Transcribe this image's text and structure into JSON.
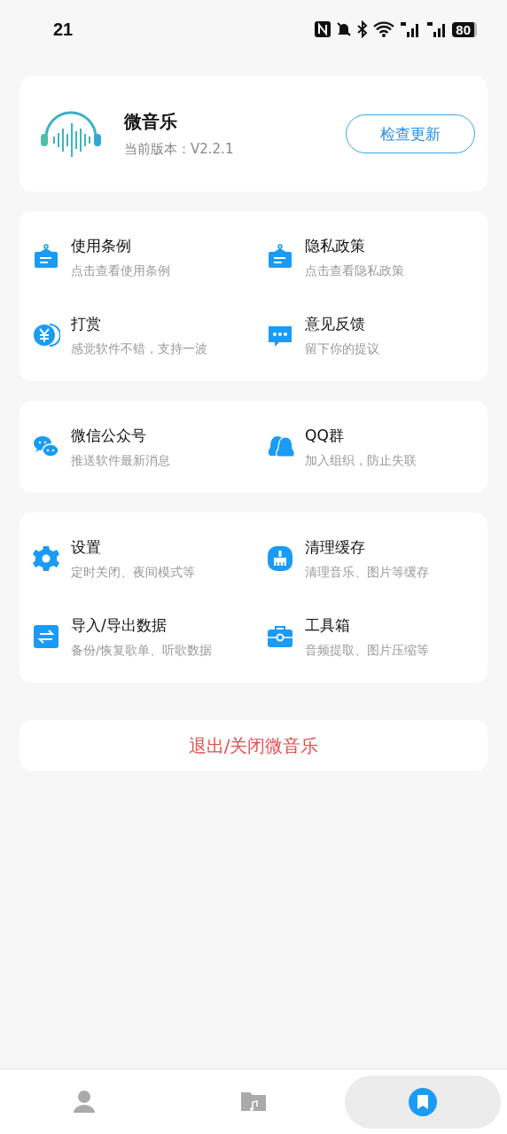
{
  "status_bar": {
    "time": "21",
    "battery": "80"
  },
  "app_card": {
    "name": "微音乐",
    "version": "当前版本：V2.2.1",
    "update_button": "检查更新"
  },
  "groups": [
    {
      "items": [
        {
          "kind": "notice",
          "title": "使用条例",
          "subtitle": "点击查看使用条例"
        },
        {
          "kind": "notice",
          "title": "隐私政策",
          "subtitle": "点击查看隐私政策"
        },
        {
          "kind": "coin",
          "title": "打赏",
          "subtitle": "感觉软件不错，支持一波"
        },
        {
          "kind": "chat",
          "title": "意见反馈",
          "subtitle": "留下你的提议"
        }
      ]
    },
    {
      "items": [
        {
          "kind": "wechat",
          "title": "微信公众号",
          "subtitle": "推送软件最新消息"
        },
        {
          "kind": "qq",
          "title": "QQ群",
          "subtitle": "加入组织，防止失联"
        }
      ]
    },
    {
      "items": [
        {
          "kind": "gear",
          "title": "设置",
          "subtitle": "定时关闭、夜间模式等"
        },
        {
          "kind": "broom",
          "title": "清理缓存",
          "subtitle": "清理音乐、图片等缓存"
        },
        {
          "kind": "swap",
          "title": "导入/导出数据",
          "subtitle": "备份/恢复歌单、听歌数据"
        },
        {
          "kind": "toolbox",
          "title": "工具箱",
          "subtitle": "音频提取、图片压缩等"
        }
      ]
    }
  ],
  "exit_button": "退出/关闭微音乐",
  "bottom_nav": [
    {
      "kind": "person",
      "selected": false
    },
    {
      "kind": "folder",
      "selected": false
    },
    {
      "kind": "bookmark",
      "selected": true
    }
  ]
}
